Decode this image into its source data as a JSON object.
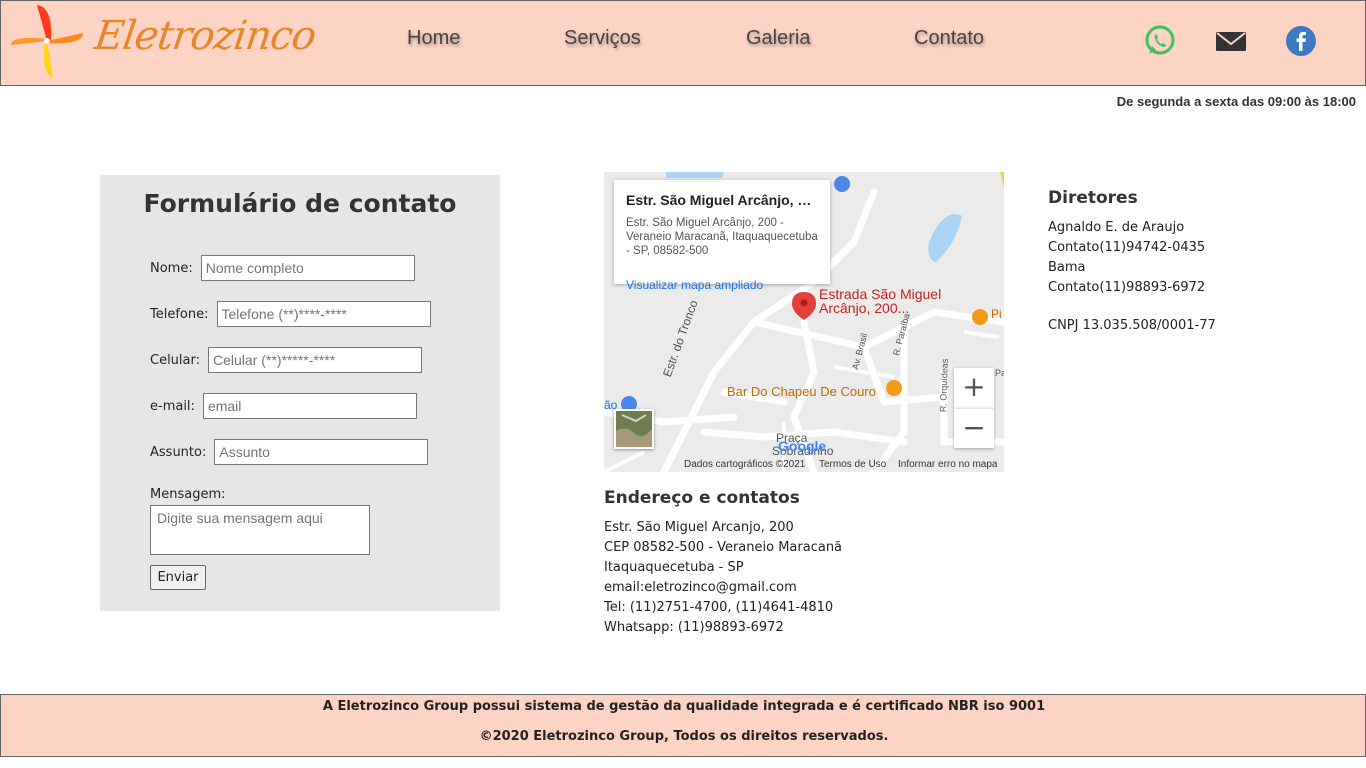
{
  "brand": {
    "name": "Eletrozinco"
  },
  "nav": {
    "items": [
      {
        "label": "Home"
      },
      {
        "label": "Serviços"
      },
      {
        "label": "Galeria"
      },
      {
        "label": "Contato"
      }
    ]
  },
  "social": {
    "icons": [
      "whatsapp-icon",
      "mail-icon",
      "facebook-icon"
    ]
  },
  "hours": "De segunda a sexta das 09:00 às 18:00",
  "form": {
    "title": "Formulário de contato",
    "fields": [
      {
        "label": "Nome:",
        "placeholder": "Nome completo",
        "value": ""
      },
      {
        "label": "Telefone:",
        "placeholder": "Telefone (**)****-****",
        "value": ""
      },
      {
        "label": "Celular:",
        "placeholder": "Celular (**)*****-****",
        "value": ""
      },
      {
        "label": "e-mail:",
        "placeholder": "email",
        "value": ""
      },
      {
        "label": "Assunto:",
        "placeholder": "Assunto",
        "value": ""
      }
    ],
    "message_label": "Mensagem:",
    "message_placeholder": "Digite sua mensagem aqui",
    "submit_label": "Enviar"
  },
  "map": {
    "popup_title": "Estr. São Miguel Arcânjo, 200 ...",
    "popup_address": "Estr. São Miguel Arcânjo, 200 - Veraneio Maracanã, Itaquaquecetuba - SP, 08582-500",
    "popup_link": "Visualizar mapa ampliado",
    "pin_label_1": "Estrada São Miguel",
    "pin_label_2": "Arcânjo, 200...",
    "place_bar": "Bar Do Chapeu De Couro",
    "place_praca": "Praça",
    "place_sobradinho": "Sobradinho",
    "street_tronco": "Estr. do Tronco",
    "street_brasil": "Av. Brasil",
    "street_paraiba": "R. Paraíba",
    "street_orquideas": "R. Orquídeas",
    "edge_label": "ão",
    "edge_label_2": "Pi",
    "edge_label_3": "Pa",
    "google": "Google",
    "zoom_in": "+",
    "zoom_out": "−",
    "attrib_data": "Dados cartográficos ©2021",
    "attrib_terms": "Termos de Uso",
    "attrib_report": "Informar erro no mapa"
  },
  "address": {
    "title": "Endereço e contatos",
    "lines": [
      "Estr. São Miguel Arcanjo, 200",
      "CEP 08582-500 - Veraneio Maracanã",
      "Itaquaquecetuba - SP",
      "email:eletrozinco@gmail.com",
      "Tel: (11)2751-4700, (11)4641-4810",
      "Whatsapp: (11)98893-6972"
    ]
  },
  "directors": {
    "title": "Diretores",
    "lines": [
      "Agnaldo E. de Araujo",
      "Contato(11)94742-0435",
      "Bama",
      "Contato(11)98893-6972"
    ],
    "cnpj": "CNPJ 13.035.508/0001-77"
  },
  "footer": {
    "line1": "A Eletrozinco Group possui sistema de gestão da qualidade integrada e é certificado NBR iso 9001",
    "line2": "©2020 Eletrozinco Group, Todos os direitos reservados."
  },
  "colors": {
    "header_bg": "#fdd3c4",
    "brand_orange": "#e8862a",
    "whatsapp": "#3fc35a",
    "facebook": "#3b79c3",
    "map_pin": "#e2413a"
  }
}
